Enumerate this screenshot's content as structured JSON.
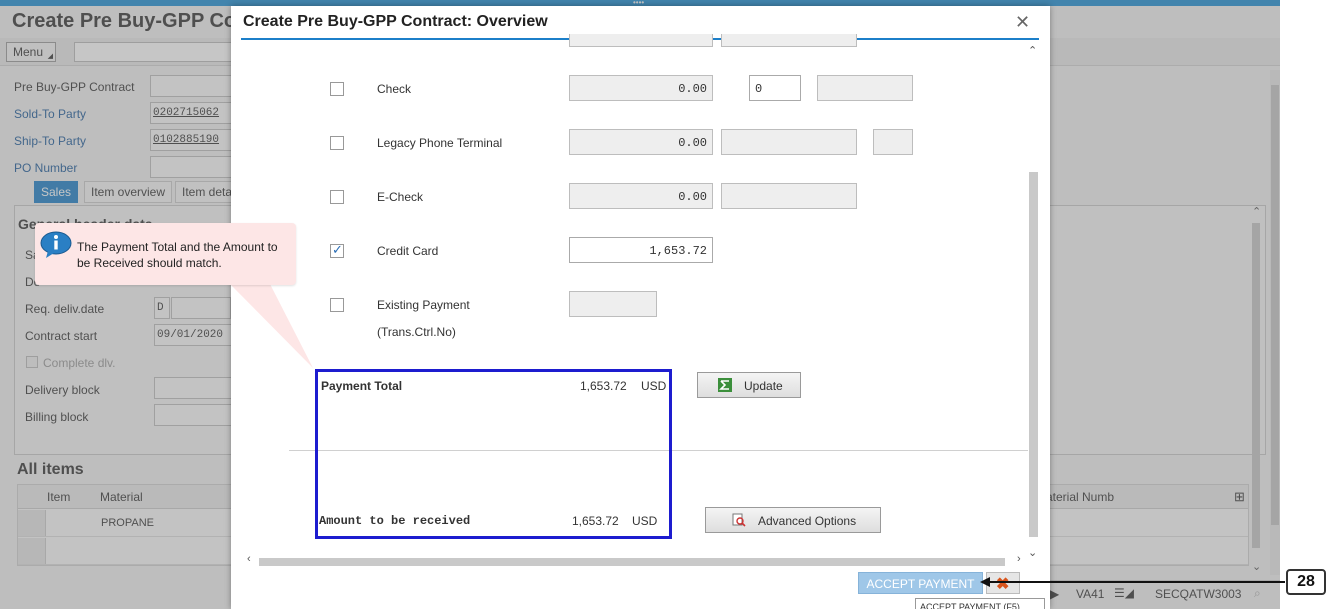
{
  "background_screen": {
    "title": "Create Pre Buy-GPP Co",
    "menu_label": "Menu",
    "fields": {
      "contract_label": "Pre Buy-GPP Contract",
      "sold_to_label": "Sold-To Party",
      "sold_to_value": "0202715062",
      "ship_to_label": "Ship-To Party",
      "ship_to_value": "0102885190",
      "po_label": "PO Number"
    },
    "tabs": [
      "Sales",
      "Item overview",
      "Item deta"
    ],
    "general_header_partial": "General header data",
    "partial_labels": [
      "Sa",
      "De"
    ],
    "req_deliv_label": "Req. deliv.date",
    "req_deliv_value": "D",
    "contract_start_label": "Contract start",
    "contract_start_value": "09/01/2020",
    "complete_dlv_label": "Complete dlv.",
    "delivery_block_label": "Delivery block",
    "billing_block_label": "Billing block",
    "all_items_title": "All items",
    "table_headers": {
      "item": "Item",
      "material": "Material",
      "material_numb": "aterial Numb"
    },
    "rows": [
      {
        "material": "PROPANE"
      }
    ],
    "status": {
      "transaction": "VA41",
      "system": "SECQATW3003"
    }
  },
  "dialog": {
    "title": "Create Pre Buy-GPP Contract: Overview",
    "payment_rows": [
      {
        "label": "Check",
        "checked": false,
        "amount": "0.00",
        "ref": "0"
      },
      {
        "label": "Legacy Phone Terminal",
        "checked": false,
        "amount": "0.00"
      },
      {
        "label": "E-Check",
        "checked": false,
        "amount": "0.00"
      },
      {
        "label": "Credit Card",
        "checked": true,
        "amount": "1,653.72"
      },
      {
        "label": "Existing Payment",
        "sublabel": "(Trans.Ctrl.No)",
        "checked": false
      }
    ],
    "payment_total_label": "Payment Total",
    "payment_total_value": "1,653.72",
    "payment_total_currency": "USD",
    "update_label": "Update",
    "amount_received_label": "Amount to be received",
    "amount_received_value": "1,653.72",
    "amount_received_currency": "USD",
    "advanced_options_label": "Advanced Options",
    "accept_label": "ACCEPT PAYMENT",
    "tooltip_partial": "ACCEPT PAYMENT (F5)"
  },
  "callout": {
    "text": "The Payment Total and the Amount to be Received should match.",
    "icon": "info-icon",
    "color": "#fde6e6"
  },
  "step": {
    "number": "28"
  },
  "colors": {
    "accent": "#1c7fc9",
    "highlight": "#1d1ccf"
  }
}
